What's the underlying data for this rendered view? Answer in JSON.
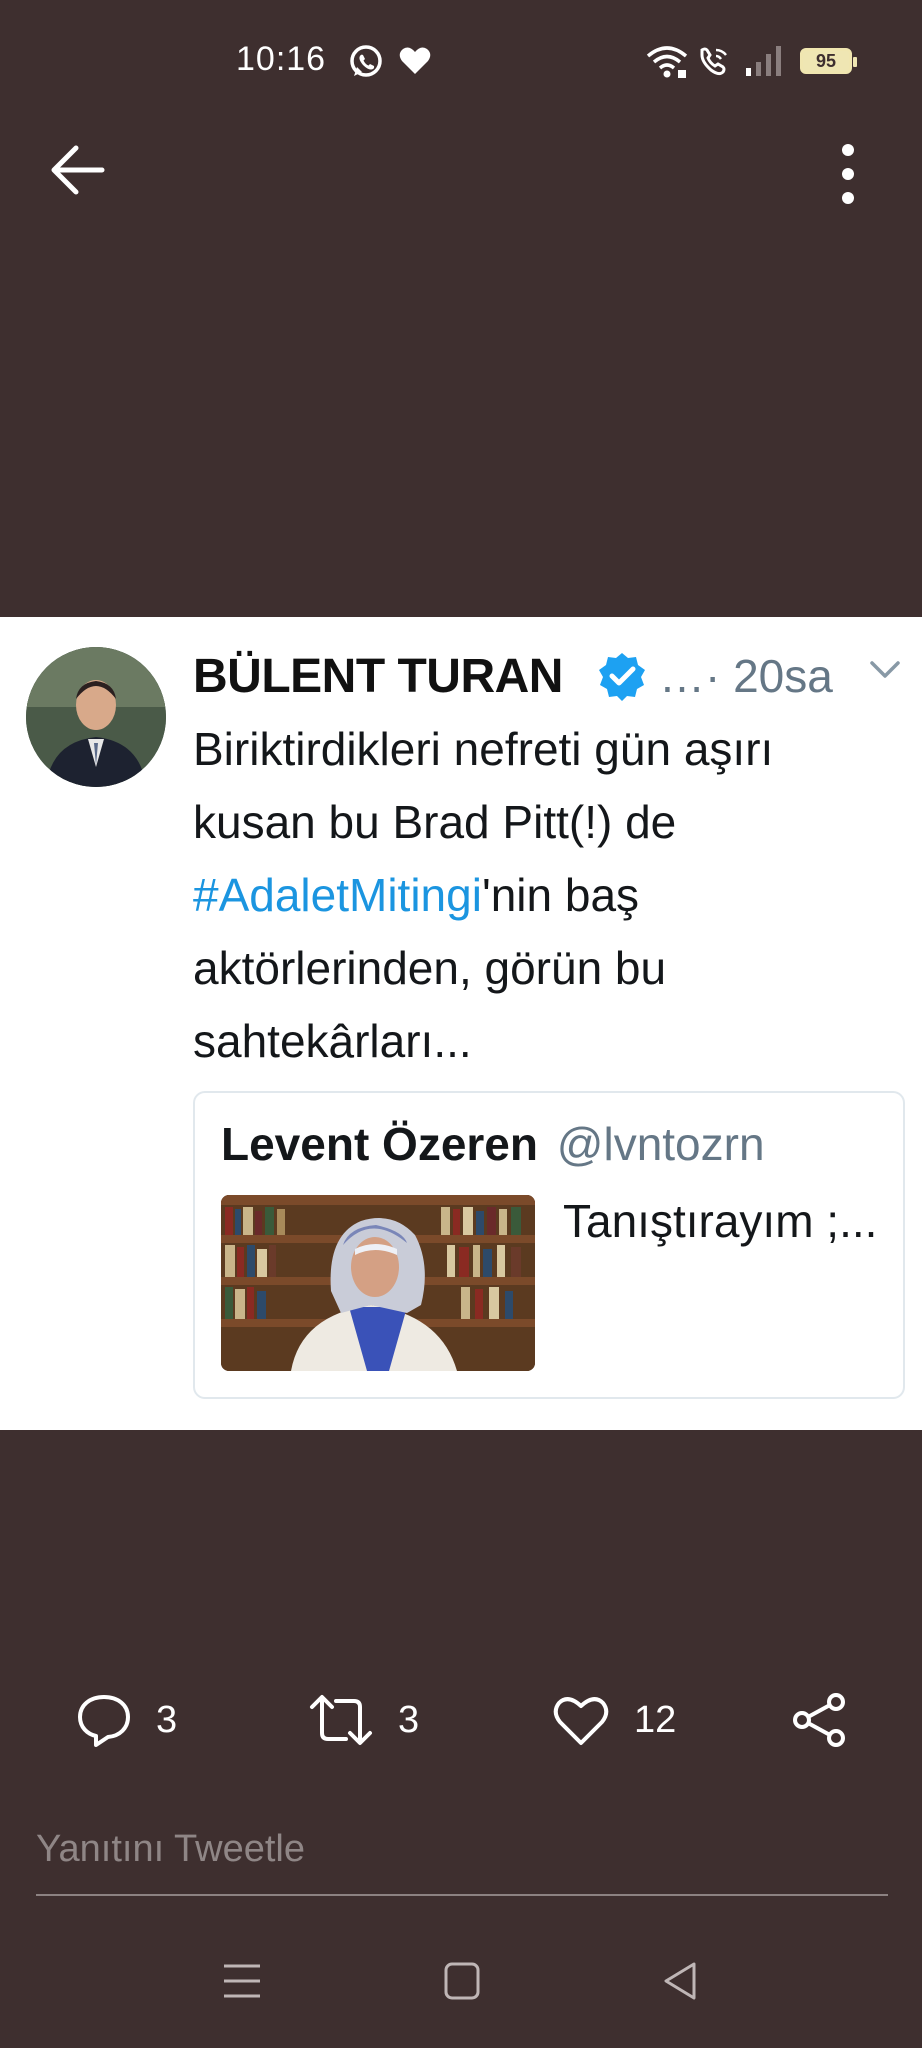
{
  "status_bar": {
    "time": "10:16",
    "battery_level": "95",
    "icons": [
      "whatsapp-icon",
      "heart-icon",
      "wifi-icon",
      "wifi-call-icon",
      "signal-icon",
      "battery-icon"
    ]
  },
  "top_bar": {
    "icons": [
      "back-arrow-icon",
      "more-vertical-icon"
    ]
  },
  "tweet": {
    "author_name": "BÜLENT TURAN",
    "verified": true,
    "meta": "…· 20sa",
    "body_before": "Biriktirdikleri nefreti gün aşırı kusan bu Brad Pitt(!) de ",
    "hashtag": "#AdaletMitingi",
    "body_after": "'nin baş aktörlerinden,  görün bu sahtekârları...",
    "quote": {
      "name": "Levent Özeren",
      "handle": "@lvntozrn",
      "text": "Tanıştırayım ;..."
    }
  },
  "actions": {
    "reply_count": "3",
    "retweet_count": "3",
    "like_count": "12"
  },
  "reply_box": {
    "placeholder": "Yanıtını Tweetle"
  },
  "colors": {
    "background": "#3e2f2f",
    "card": "#ffffff",
    "link": "#1b95e0",
    "verified": "#1da1f2"
  }
}
